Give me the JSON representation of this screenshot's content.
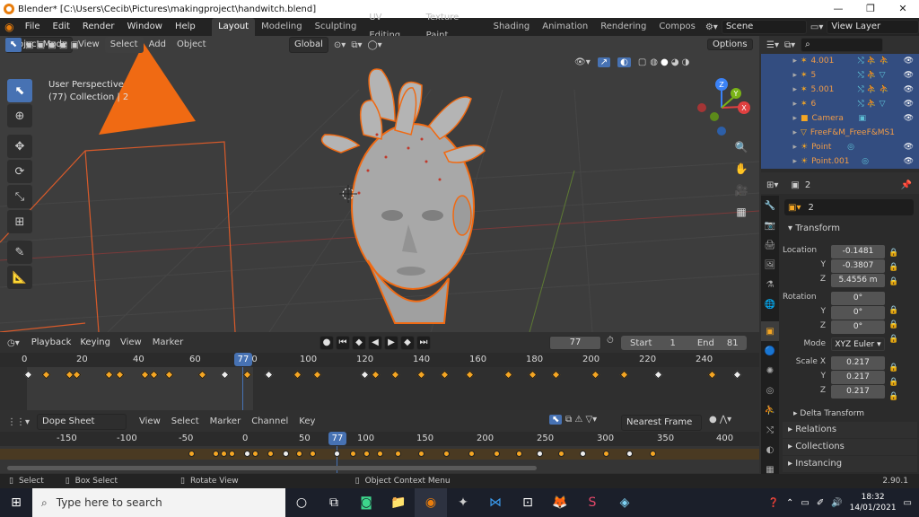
{
  "window": {
    "title": "Blender* [C:\\Users\\Cecib\\Pictures\\makingproject\\handwitch.blend]",
    "minimize": "—",
    "maximize": "❐",
    "close": "✕"
  },
  "menu": [
    "File",
    "Edit",
    "Render",
    "Window",
    "Help"
  ],
  "workspaces": [
    "Layout",
    "Modeling",
    "Sculpting",
    "UV Editing",
    "Texture Paint",
    "Shading",
    "Animation",
    "Rendering",
    "Compos"
  ],
  "scene": "Scene",
  "view_layer": "View Layer",
  "viewport": {
    "mode": "Object Mode",
    "menus": [
      "View",
      "Select",
      "Add",
      "Object"
    ],
    "transform_orientation": "Global",
    "options": "Options",
    "overlay_title": "User Perspective",
    "overlay_sub": "(77) Collection | 2",
    "gizmo": {
      "z": "Z",
      "y": "Y",
      "x": "X"
    }
  },
  "timeline": {
    "menus": [
      "Playback",
      "Keying",
      "View",
      "Marker"
    ],
    "current_frame": "77",
    "start_label": "Start",
    "start": "1",
    "end_label": "End",
    "end": "81",
    "ruler": [
      "0",
      "20",
      "40",
      "60",
      "80",
      "100",
      "120",
      "140",
      "160",
      "180",
      "200",
      "220",
      "240"
    ],
    "playhead": "77"
  },
  "dopesheet": {
    "mode": "Dope Sheet",
    "menus": [
      "View",
      "Select",
      "Marker",
      "Channel",
      "Key"
    ],
    "snap": "Nearest Frame",
    "ruler": [
      "-150",
      "-100",
      "-50",
      "0",
      "50",
      "100",
      "150",
      "200",
      "250",
      "300",
      "350",
      "400"
    ],
    "playhead": "77"
  },
  "status": {
    "select": "Select",
    "box_select": "Box Select",
    "rotate": "Rotate View",
    "context": "Object Context Menu",
    "version": "2.90.1"
  },
  "outliner": {
    "items": [
      {
        "name": "4.001"
      },
      {
        "name": "5"
      },
      {
        "name": "5.001"
      },
      {
        "name": "6"
      },
      {
        "name": "Camera"
      },
      {
        "name": "FreeF&M_FreeF&MS1"
      },
      {
        "name": "Point"
      },
      {
        "name": "Point.001"
      }
    ]
  },
  "properties": {
    "object_name": "2",
    "name_field": "2",
    "transform": "Transform",
    "location_label": "Location",
    "location": {
      "x": "-0.1481",
      "y": "-0.3807",
      "z": "5.4556 m"
    },
    "rotation_label": "Rotation",
    "rotation": {
      "x": "0°",
      "y": "0°",
      "z": "0°"
    },
    "mode_label": "Mode",
    "mode": "XYZ Euler",
    "scale_label": "Scale X",
    "scale": {
      "x": "0.217",
      "y": "0.217",
      "z": "0.217"
    },
    "axis_y": "Y",
    "axis_z": "Z",
    "delta": "Delta Transform",
    "relations": "Relations",
    "collections": "Collections",
    "instancing": "Instancing"
  },
  "taskbar": {
    "search_placeholder": "Type here to search",
    "time": "18:32",
    "date": "14/01/2021"
  }
}
